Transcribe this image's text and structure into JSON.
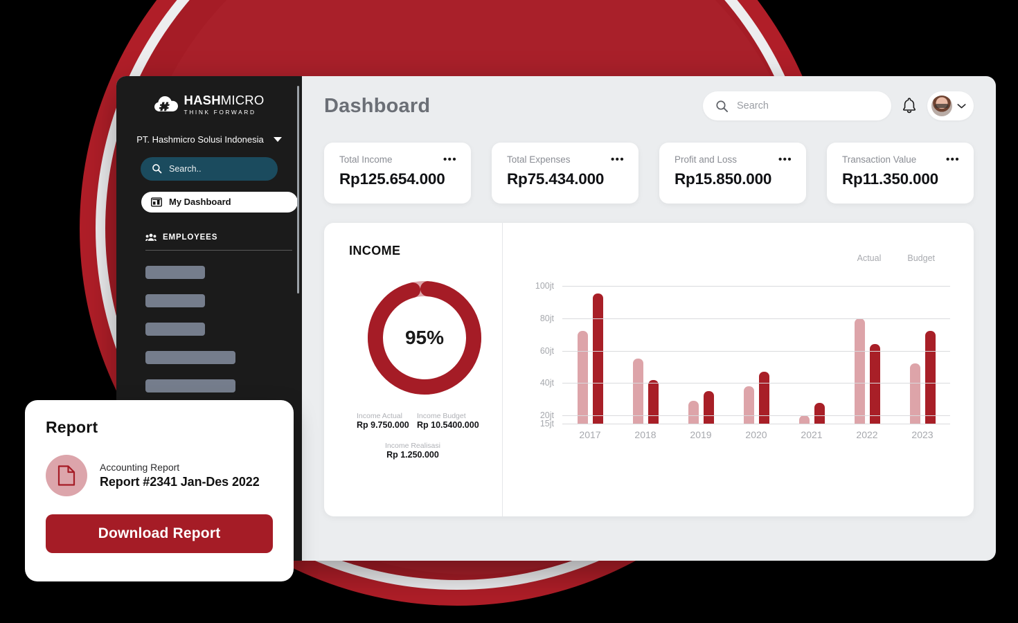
{
  "brand": {
    "logo_top_bold": "HASH",
    "logo_top_light": "MICRO",
    "logo_sub": "THINK FORWARD",
    "accent_dark_red": "#A51C26",
    "accent_light_pink": "#DDA4A9",
    "sidebar_bg": "#1B1B1B",
    "search_teal": "#1B4B5E"
  },
  "sidebar": {
    "company": "PT. Hashmicro Solusi Indonesia",
    "company_caret_icon": "chevron-down-icon",
    "search_placeholder": "Search..",
    "search_icon": "search-icon",
    "nav_active": {
      "label": "My Dashboard",
      "icon": "dashboard-icon"
    },
    "section": {
      "label": "EMPLOYEES",
      "icon": "people-icon"
    },
    "skeleton_widths": [
      86,
      86,
      86,
      130,
      130
    ]
  },
  "header": {
    "title": "Dashboard",
    "search_placeholder": "Search",
    "search_icon": "search-icon",
    "bell_icon": "bell-icon",
    "avatar_icon": "avatar",
    "profile_caret_icon": "chevron-down-icon"
  },
  "kpis": [
    {
      "label": "Total Income",
      "value": "Rp125.654.000",
      "menu_icon": "more-horizontal-icon"
    },
    {
      "label": "Total Expenses",
      "value": "Rp75.434.000",
      "menu_icon": "more-horizontal-icon"
    },
    {
      "label": "Profit and Loss",
      "value": "Rp15.850.000",
      "menu_icon": "more-horizontal-icon"
    },
    {
      "label": "Transaction Value",
      "value": "Rp11.350.000",
      "menu_icon": "more-horizontal-icon"
    }
  ],
  "income_panel": {
    "title": "INCOME",
    "donut_percent_label": "95%",
    "stats": [
      {
        "key": "Income Actual",
        "value": "Rp 9.750.000"
      },
      {
        "key": "Income Budget",
        "value": "Rp 10.5400.000"
      },
      {
        "key": "Income Realisasi",
        "value": "Rp 1.250.000"
      }
    ]
  },
  "chart_data": {
    "type": "bar",
    "title": "INCOME",
    "categories": [
      "2017",
      "2018",
      "2019",
      "2020",
      "2021",
      "2022",
      "2023"
    ],
    "series": [
      {
        "name": "Actual",
        "color": "#DDA4A9",
        "values": [
          72,
          55,
          29,
          38,
          20,
          80,
          52
        ]
      },
      {
        "name": "Budget",
        "color": "#A81F27",
        "values": [
          95,
          42,
          35,
          47,
          28,
          64,
          72
        ]
      }
    ],
    "ytick_labels": [
      "100jt",
      "80jt",
      "60jt",
      "40jt",
      "20jt",
      "15jt"
    ],
    "ytick_values": [
      100,
      80,
      60,
      40,
      20,
      15
    ],
    "ylim": [
      15,
      108
    ],
    "xlabel": "",
    "ylabel": "",
    "grid": true,
    "legend_position": "top-right"
  },
  "report_card": {
    "title": "Report",
    "doc_icon": "document-icon",
    "subtitle": "Accounting Report",
    "name": "Report #2341 Jan-Des 2022",
    "button_label": "Download Report"
  }
}
